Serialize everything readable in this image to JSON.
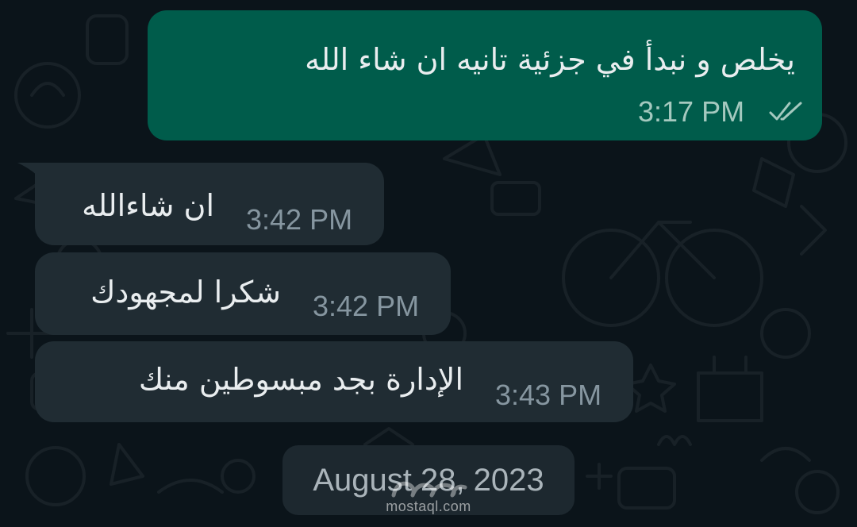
{
  "chat": {
    "messages": [
      {
        "direction": "outgoing",
        "text": "يخلص و نبدأ في جزئية تانيه ان شاء الله",
        "time": "3:17 PM",
        "status_icon": "double-check-icon"
      },
      {
        "direction": "incoming",
        "text": "ان شاءالله",
        "time": "3:42 PM"
      },
      {
        "direction": "incoming",
        "text": "شكرا لمجهودك",
        "time": "3:42 PM"
      },
      {
        "direction": "incoming",
        "text": "الإدارة بجد مبسوطين منك",
        "time": "3:43 PM"
      }
    ],
    "date_separator": "August 28, 2023"
  },
  "watermark": {
    "site": "mostaql.com"
  },
  "colors": {
    "background": "#0b141a",
    "outgoing_bubble": "#005c4b",
    "incoming_bubble": "#202c33",
    "timestamp": "#8696a0"
  }
}
